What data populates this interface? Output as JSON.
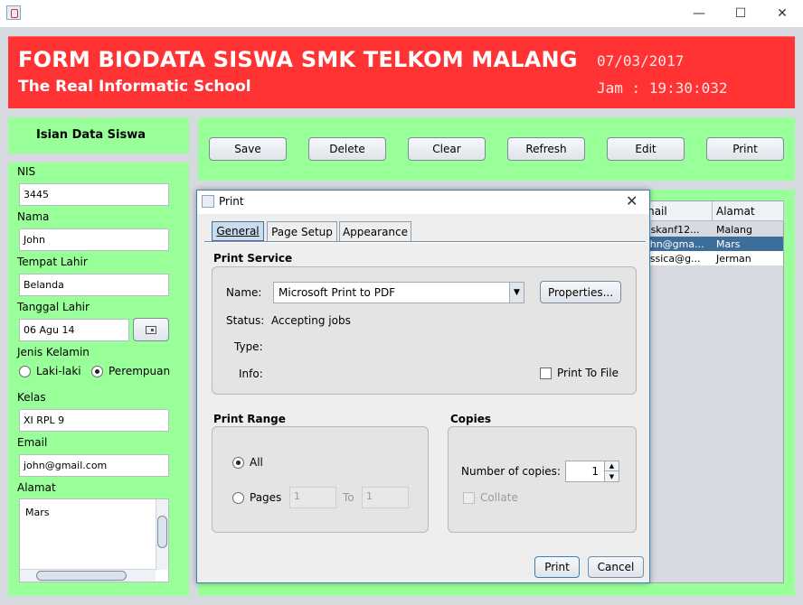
{
  "window": {
    "minimize_glyph": "—",
    "maximize_glyph": "☐",
    "close_glyph": "✕"
  },
  "header": {
    "title": "FORM BIODATA SISWA SMK TELKOM MALANG",
    "subtitle": "The Real Informatic School",
    "date": "07/03/2017",
    "time": "Jam : 19:30:032"
  },
  "left_panel": {
    "title": "Isian Data Siswa",
    "fields": {
      "nis_label": "NIS",
      "nis_value": "3445",
      "nama_label": "Nama",
      "nama_value": "John",
      "tempat_label": "Tempat Lahir",
      "tempat_value": "Belanda",
      "tanggal_label": "Tanggal Lahir",
      "tanggal_value": "06 Agu 14",
      "jk_label": "Jenis Kelamin",
      "jk_option_male": "Laki-laki",
      "jk_option_female": "Perempuan",
      "jk_selected": "Perempuan",
      "kelas_label": "Kelas",
      "kelas_value": "XI RPL 9",
      "email_label": "Email",
      "email_value": "john@gmail.com",
      "alamat_label": "Alamat",
      "alamat_value": "Mars"
    }
  },
  "toolbar": {
    "save": "Save",
    "delete": "Delete",
    "clear": "Clear",
    "refresh": "Refresh",
    "edit": "Edit",
    "print": "Print"
  },
  "table": {
    "columns": [
      "mail",
      "Alamat"
    ],
    "rows": [
      {
        "email": "riskanf12...",
        "alamat": "Malang",
        "selected": false
      },
      {
        "email": "ohn@gma...",
        "alamat": "Mars",
        "selected": true
      },
      {
        "email": "essica@g...",
        "alamat": "Jerman",
        "selected": false
      }
    ]
  },
  "dialog": {
    "title": "Print",
    "tabs": [
      "General",
      "Page Setup",
      "Appearance"
    ],
    "active_tab": "General",
    "print_service": {
      "title": "Print Service",
      "name_label": "Name:",
      "name_value": "Microsoft Print to PDF",
      "properties": "Properties...",
      "status_label": "Status:",
      "status_value": "Accepting jobs",
      "type_label": "Type:",
      "info_label": "Info:",
      "print_to_file": "Print To File"
    },
    "print_range": {
      "title": "Print Range",
      "all": "All",
      "pages": "Pages",
      "from_value": "1",
      "to_label": "To",
      "to_value": "1"
    },
    "copies": {
      "title": "Copies",
      "number_label": "Number of copies:",
      "number_value": "1",
      "collate": "Collate"
    },
    "print_button": "Print",
    "cancel_button": "Cancel"
  },
  "colors": {
    "header_bg": "#ff3333",
    "panel_green": "#99ff99",
    "selection": "#3d6e99"
  }
}
